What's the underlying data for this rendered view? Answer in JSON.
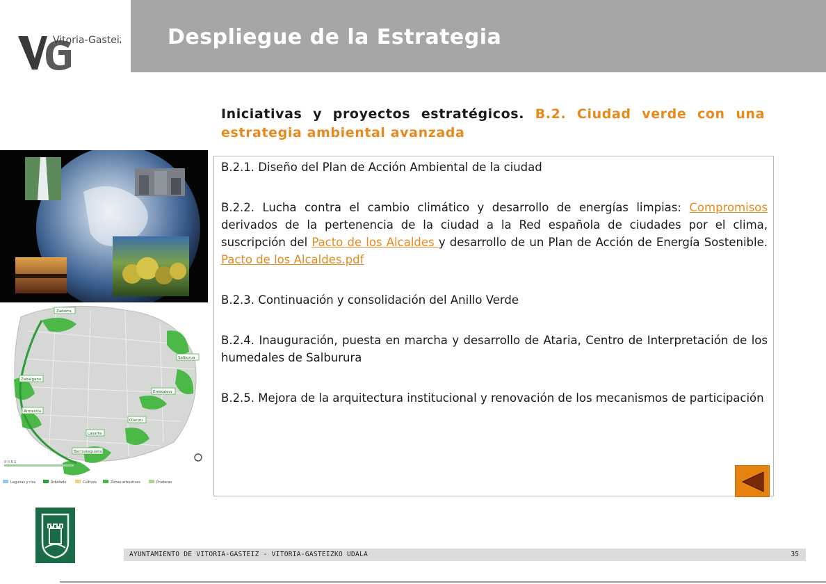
{
  "header": {
    "logo_text": "Vitoria-Gasteiz",
    "logo_initials": "VG",
    "title": "Despliegue de la Estrategia"
  },
  "heading": {
    "part1": "Iniciativas y proyectos estratégicos.",
    "part2": "B.2. Ciudad verde con una estrategia ambiental avanzada"
  },
  "items": {
    "b21": {
      "text": "B.2.1. Diseño del Plan de Acción Ambiental de la ciudad"
    },
    "b22": {
      "text1": "B.2.2. Lucha contra el cambio climático y desarrollo de energías limpias: ",
      "link1": "Compromisos",
      "text2": " derivados de la pertenencia de la ciudad a la Red española de ciudades por el clima, suscripción del ",
      "link2": "Pacto de los Alcaldes ",
      "text3": "y desarrollo de un Plan de Acción de Energía Sostenible. ",
      "link3": "Pacto de los Alcaldes.pdf"
    },
    "b23": {
      "text": "B.2.3. Continuación y consolidación del Anillo Verde"
    },
    "b24": {
      "text": "B.2.4. Inauguración, puesta en marcha y desarrollo de Ataria, Centro de Interpretación de los humedales de Salburura"
    },
    "b25": {
      "text": "B.2.5. Mejora de la arquitectura institucional y renovación de los mecanismos de participación"
    }
  },
  "map": {
    "labels": [
      "Zadorra",
      "Zabalgana",
      "Salburua",
      "Errekaleor",
      "Armentia",
      "Olarizu",
      "Lasarte",
      "Berrosteguieta"
    ],
    "legend": [
      "Lagunas y ríos",
      "Arbolado",
      "Cultivos",
      "Zonas arbustivas",
      "Praderas"
    ]
  },
  "footer": {
    "text": "AYUNTAMIENTO DE VITORIA-GASTEIZ - VITORIA-GASTEIZKO UDALA",
    "page": "35"
  },
  "colors": {
    "accent": "#e68a1e",
    "title_bar": "#a6a6a6",
    "crest_green": "#1c6b48"
  },
  "icons": {
    "back": "triangle-left-icon"
  }
}
